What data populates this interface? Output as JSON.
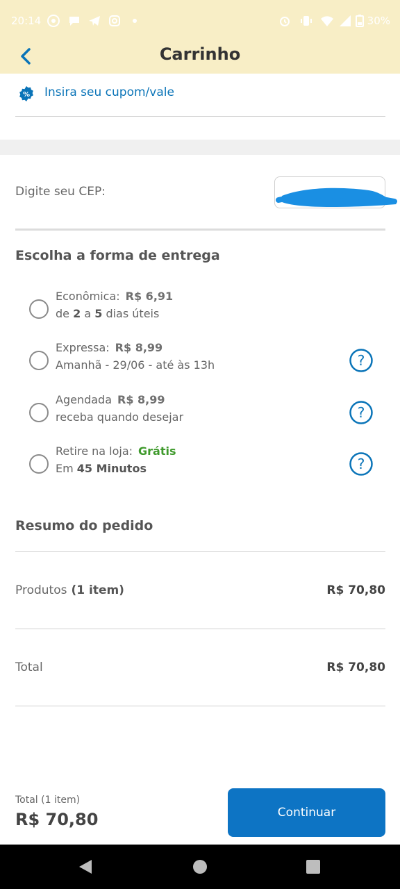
{
  "status_bar": {
    "time": "20:14",
    "battery": "30%"
  },
  "header": {
    "title": "Carrinho"
  },
  "coupon": {
    "label": "Insira seu cupom/vale"
  },
  "cep": {
    "label": "Digite seu CEP:",
    "value": ""
  },
  "delivery": {
    "title": "Escolha a forma de entrega",
    "options": [
      {
        "name": "Econômica:",
        "price": "R$ 6,91",
        "detail_parts": [
          "de ",
          "2",
          " a ",
          "5",
          " dias úteis"
        ],
        "has_help": false
      },
      {
        "name": "Expressa:",
        "price": "R$ 8,99",
        "detail": "Amanhã - 29/06 - até às 13h",
        "has_help": true
      },
      {
        "name": "Agendada",
        "price": "R$ 8,99",
        "detail": "receba quando desejar",
        "has_help": true
      },
      {
        "name": "Retire na loja:",
        "price": "Grátis",
        "detail_prefix": "Em ",
        "detail_bold": "45 Minutos",
        "has_help": true
      }
    ]
  },
  "summary": {
    "title": "Resumo do pedido",
    "products_label": "Produtos",
    "products_count": "(1 item)",
    "products_value": "R$ 70,80",
    "total_label": "Total",
    "total_value": "R$ 70,80"
  },
  "footer": {
    "total_label": "Total",
    "items_label": "(1 item)",
    "total_value": "R$ 70,80",
    "continue_label": "Continuar"
  },
  "colors": {
    "accent": "#0d74c4",
    "header_bg": "#f8eec6",
    "free_green": "#3f9a2c",
    "link_blue": "#0a74b8"
  }
}
